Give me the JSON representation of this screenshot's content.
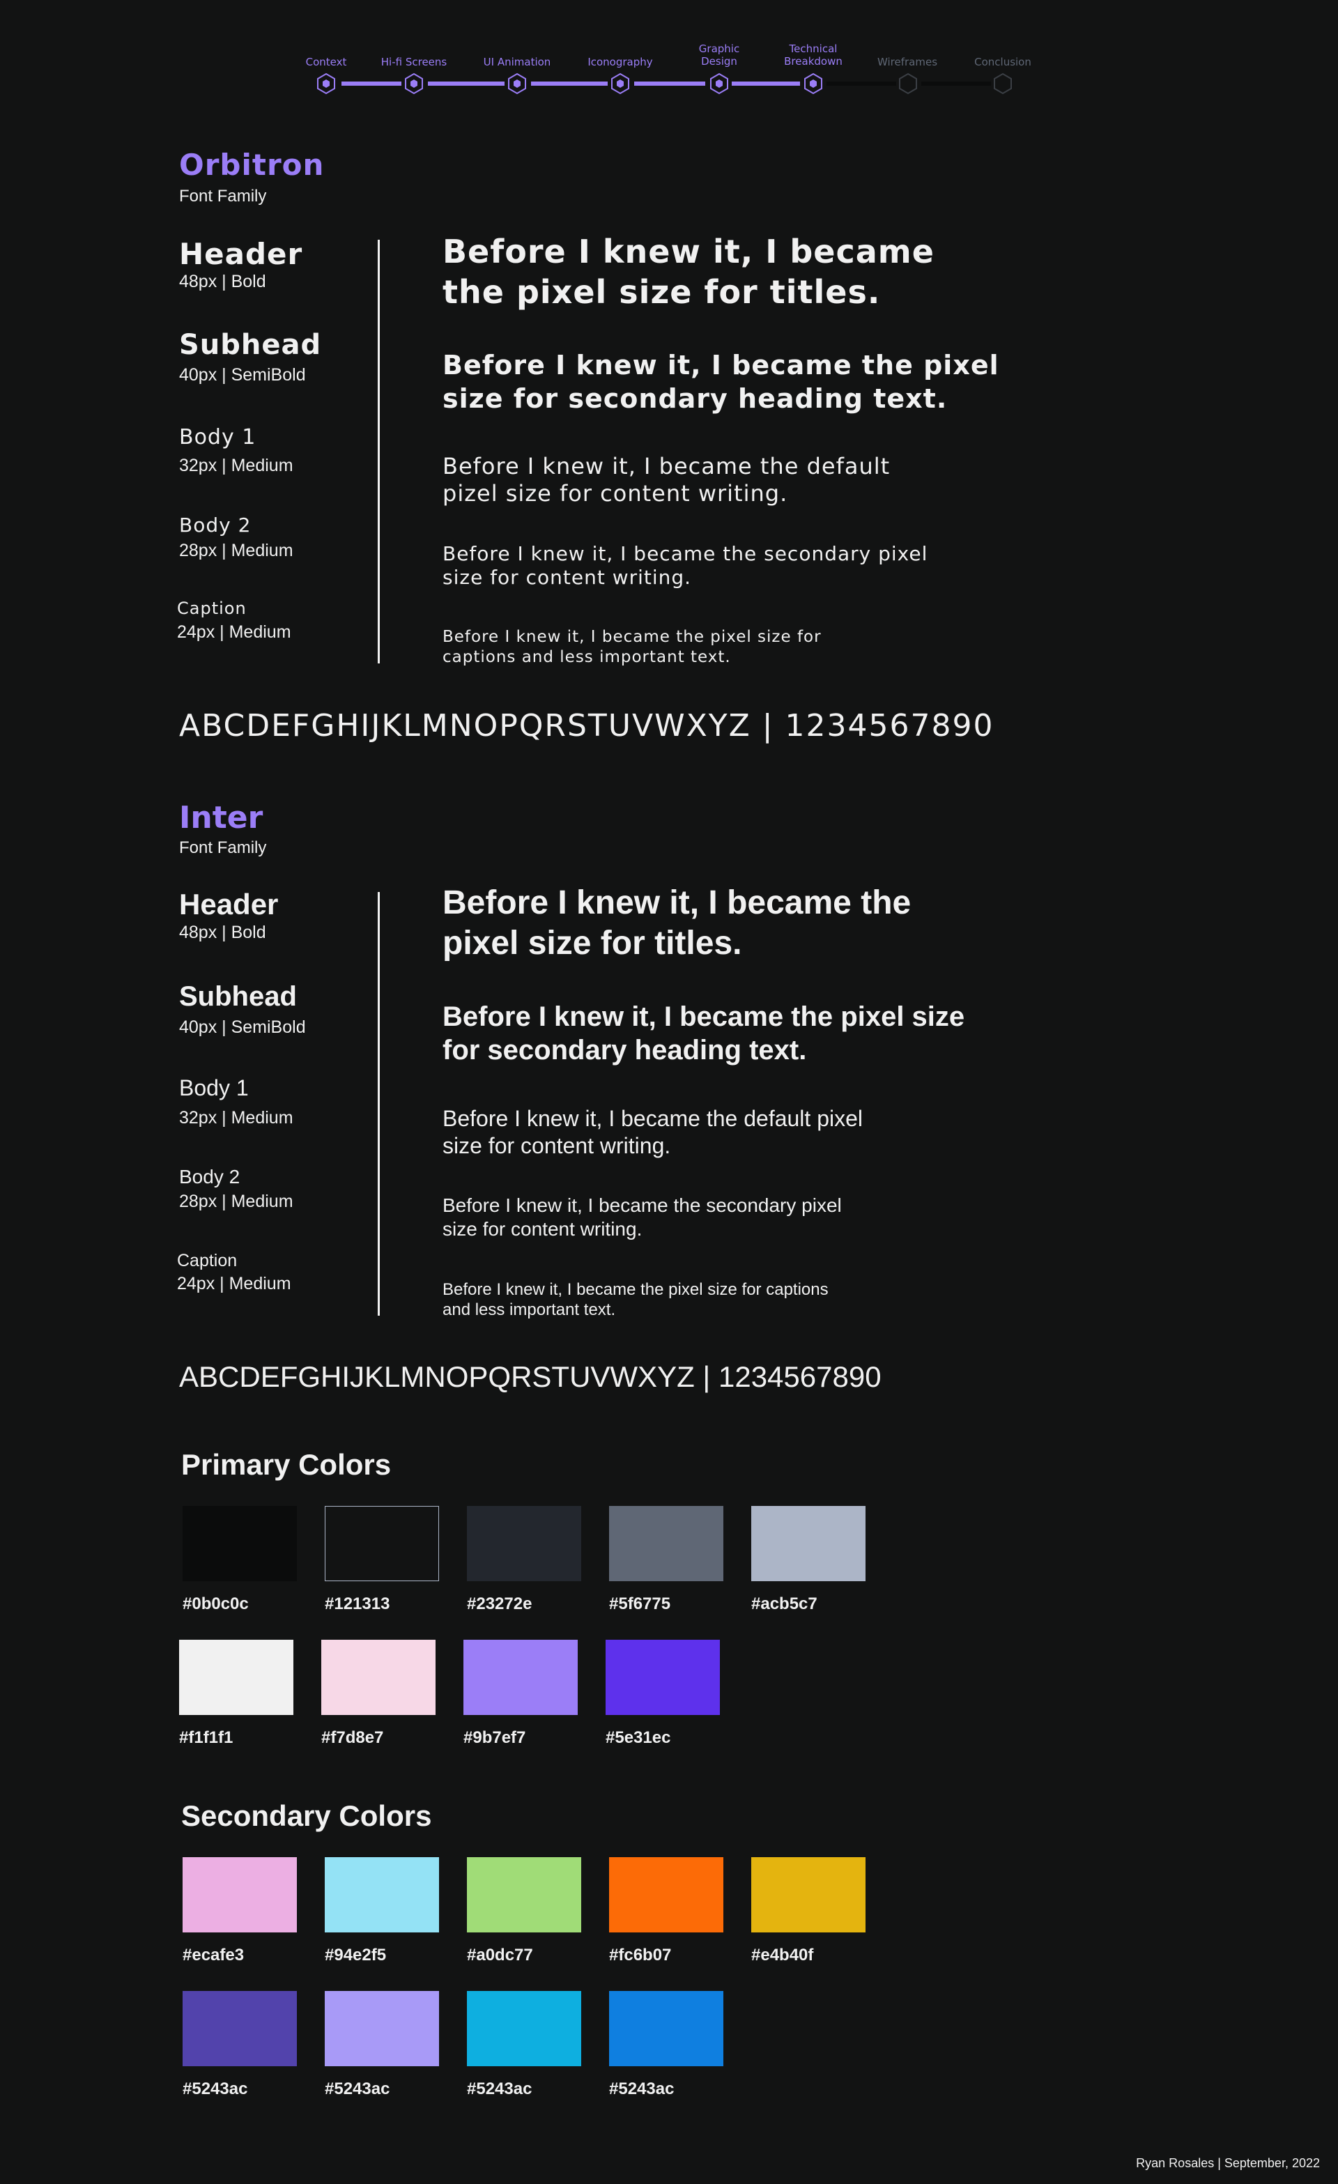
{
  "stepper": {
    "steps": [
      {
        "label": "Context",
        "state": "active"
      },
      {
        "label": "Hi-fi Screens",
        "state": "active"
      },
      {
        "label": "UI Animation",
        "state": "active"
      },
      {
        "label": "Iconography",
        "state": "active"
      },
      {
        "label": "Graphic\nDesign",
        "state": "active"
      },
      {
        "label": "Technical\nBreakdown",
        "state": "active"
      },
      {
        "label": "Wireframes",
        "state": "inactive"
      },
      {
        "label": "Conclusion",
        "state": "inactive"
      }
    ],
    "active_color": "#9b7ef7",
    "inactive_color": "#5f6775"
  },
  "orbitron": {
    "name": "Orbitron",
    "subtitle": "Font Family",
    "specs": [
      {
        "name": "Header",
        "meta": "48px | Bold",
        "sample": "Before I knew it, I became the pixel size for titles."
      },
      {
        "name": "Subhead",
        "meta": "40px | SemiBold",
        "sample": "Before I knew it, I became the pixel size for secondary heading text."
      },
      {
        "name": "Body 1",
        "meta": "32px | Medium",
        "sample": "Before I knew it, I became the default pizel size for content writing."
      },
      {
        "name": "Body 2",
        "meta": "28px | Medium",
        "sample": "Before I knew it, I became the secondary pixel size for content writing."
      },
      {
        "name": "Caption",
        "meta": "24px | Medium",
        "sample": "Before I knew it, I became the pixel size for captions and less important text."
      }
    ],
    "alphabet": "ABCDEFGHIJKLMNOPQRSTUVWXYZ | 1234567890"
  },
  "inter": {
    "name": "Inter",
    "subtitle": "Font Family",
    "specs": [
      {
        "name": "Header",
        "meta": "48px | Bold",
        "sample": "Before I knew it, I became the pixel size for titles."
      },
      {
        "name": "Subhead",
        "meta": "40px | SemiBold",
        "sample": "Before I knew it, I became the pixel size for secondary heading text."
      },
      {
        "name": "Body 1",
        "meta": "32px | Medium",
        "sample": "Before I knew it, I became the default pixel size for content writing."
      },
      {
        "name": "Body 2",
        "meta": "28px | Medium",
        "sample": "Before I knew it, I became the secondary pixel size for content writing."
      },
      {
        "name": "Caption",
        "meta": "24px | Medium",
        "sample": "Before I knew it, I became the pixel size for captions and less important text."
      }
    ],
    "alphabet": "ABCDEFGHIJKLMNOPQRSTUVWXYZ | 1234567890"
  },
  "primary_colors": {
    "title": "Primary Colors",
    "swatches": [
      {
        "hex": "#0b0c0c",
        "label": "#0b0c0c"
      },
      {
        "hex": "#121313",
        "label": "#121313"
      },
      {
        "hex": "#23272e",
        "label": "#23272e"
      },
      {
        "hex": "#5f6775",
        "label": "#5f6775"
      },
      {
        "hex": "#acb5c7",
        "label": "#acb5c7"
      },
      {
        "hex": "#f1f1f1",
        "label": "#f1f1f1"
      },
      {
        "hex": "#f7d8e7",
        "label": "#f7d8e7"
      },
      {
        "hex": "#9b7ef7",
        "label": "#9b7ef7"
      },
      {
        "hex": "#5e31ec",
        "label": "#5e31ec"
      }
    ]
  },
  "secondary_colors": {
    "title": "Secondary Colors",
    "swatches": [
      {
        "hex": "#ecafe3",
        "label": "#ecafe3"
      },
      {
        "hex": "#94e2f5",
        "label": "#94e2f5"
      },
      {
        "hex": "#a0dc77",
        "label": "#a0dc77"
      },
      {
        "hex": "#fc6b07",
        "label": "#fc6b07"
      },
      {
        "hex": "#e4b40f",
        "label": "#e4b40f"
      },
      {
        "hex": "#5243ac",
        "label": "#5243ac"
      },
      {
        "hex": "#a89af7",
        "label": "#5243ac"
      },
      {
        "hex": "#0eafe0",
        "label": "#5243ac"
      },
      {
        "hex": "#0f7fe0",
        "label": "#5243ac"
      }
    ]
  },
  "footer": {
    "text": "Ryan Rosales | September, 2022"
  }
}
